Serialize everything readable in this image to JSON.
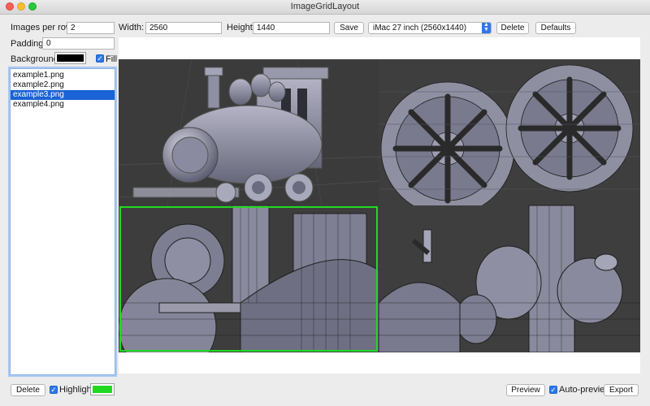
{
  "window": {
    "title": "ImageGridLayout"
  },
  "toolbar": {
    "images_per_row_label": "Images per row:",
    "images_per_row_value": "2",
    "width_label": "Width:",
    "width_value": "2560",
    "height_label": "Height:",
    "height_value": "1440",
    "save_label": "Save",
    "preset_selected": "iMac 27 inch (2560x1440)",
    "delete_label": "Delete",
    "defaults_label": "Defaults"
  },
  "sidebar": {
    "padding_label": "Padding:",
    "padding_value": "0",
    "background_label": "Background:",
    "background_color": "#000000",
    "fill_label": "Fill",
    "fill_checked": true,
    "files": [
      {
        "name": "example1.png",
        "selected": false
      },
      {
        "name": "example2.png",
        "selected": false
      },
      {
        "name": "example3.png",
        "selected": true
      },
      {
        "name": "example4.png",
        "selected": false
      }
    ]
  },
  "bottom": {
    "delete_label": "Delete",
    "highlight_label": "Highlight",
    "highlight_checked": true,
    "highlight_color": "#22d922",
    "preview_label": "Preview",
    "auto_preview_label": "Auto-preview",
    "auto_preview_checked": true,
    "export_label": "Export"
  },
  "preview": {
    "images": [
      "locomotive-render",
      "wheels-wireframe",
      "boiler-wireframe-closeup",
      "domes-wireframe"
    ],
    "highlighted_index": 2
  },
  "colors": {
    "accent": "#2d79e8",
    "selection": "#1a63d6",
    "highlight": "#22d922",
    "preview_background": "#3f3f3f"
  }
}
